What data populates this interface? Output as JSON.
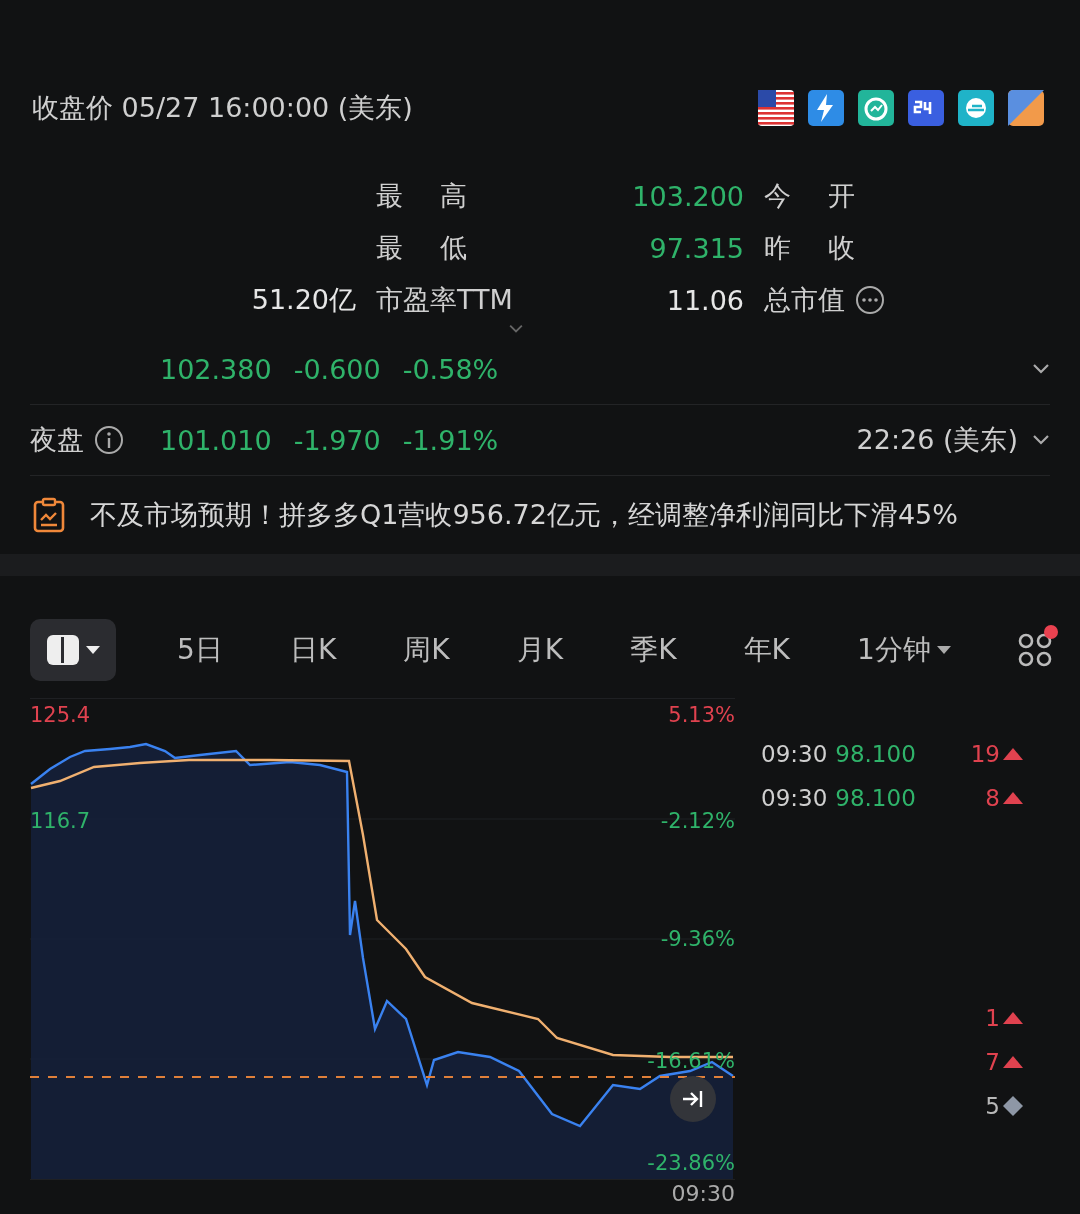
{
  "header": {
    "title": "收盘价 05/27 16:00:00 (美东)"
  },
  "stats": [
    {
      "cells": [
        {
          "kind": "empty"
        },
        {
          "kind": "label",
          "text": "最 高"
        },
        {
          "kind": "value",
          "text": "103.200",
          "color": "#2fb36a"
        },
        {
          "kind": "label",
          "text": "今 开"
        }
      ]
    },
    {
      "cells": [
        {
          "kind": "empty"
        },
        {
          "kind": "label",
          "text": "最 低"
        },
        {
          "kind": "value",
          "text": "97.315",
          "color": "#2fb36a"
        },
        {
          "kind": "label",
          "text": "昨 收"
        }
      ]
    },
    {
      "cells": [
        {
          "kind": "value",
          "text": "51.20亿",
          "color": "#e6e6e6"
        },
        {
          "kind": "label",
          "text": "市盈率TTM"
        },
        {
          "kind": "value",
          "text": "11.06",
          "color": "#e6e6e6"
        },
        {
          "kind": "label",
          "text": "总市值",
          "info": true
        }
      ]
    }
  ],
  "quotes": [
    {
      "values": [
        {
          "text": "102.380",
          "color": "#2fb36a"
        },
        {
          "text": "-0.600",
          "color": "#2fb36a"
        },
        {
          "text": "-0.58%",
          "color": "#2fb36a"
        }
      ]
    },
    {
      "label": "夜盘",
      "time": "22:26 (美东)",
      "values": [
        {
          "text": "101.010",
          "color": "#2fb36a"
        },
        {
          "text": "-1.970",
          "color": "#2fb36a"
        },
        {
          "text": "-1.91%",
          "color": "#2fb36a"
        }
      ]
    }
  ],
  "news": {
    "text": "不及市场预期！拼多多Q1营收956.72亿元，经调整净利润同比下滑45%"
  },
  "tabs": [
    {
      "kind": "layout"
    },
    {
      "kind": "text",
      "label": "5日",
      "selected": false
    },
    {
      "kind": "text",
      "label": "日K",
      "selected": false
    },
    {
      "kind": "text",
      "label": "周K",
      "selected": false
    },
    {
      "kind": "text",
      "label": "月K",
      "selected": false
    },
    {
      "kind": "text",
      "label": "季K",
      "selected": false
    },
    {
      "kind": "text",
      "label": "年K",
      "selected": false
    },
    {
      "kind": "dropdown",
      "label": "1分钟",
      "selected": false
    },
    {
      "kind": "grid",
      "badge": true
    }
  ],
  "chart": {
    "left_labels": [
      {
        "text": "125.4",
        "color": "#e0424f"
      },
      {
        "text": "116.7",
        "color": "#2fb36a"
      }
    ],
    "right_labels": [
      {
        "text": "5.13%",
        "color": "#e0424f"
      },
      {
        "text": "-2.12%",
        "color": "#2fb36a"
      },
      {
        "text": "-9.36%",
        "color": "#2fb36a"
      },
      {
        "text": "-16.61%",
        "color": "#2fb36a"
      },
      {
        "text": "-23.86%",
        "color": "#2fb36a"
      }
    ],
    "x_label": "09:30"
  },
  "trades": [
    {
      "kind": "up",
      "time": "09:30",
      "price": "98.100",
      "volume": "19"
    },
    {
      "kind": "up",
      "time": "09:30",
      "price": "98.100",
      "volume": "8"
    },
    {
      "kind": "blurred"
    },
    {
      "kind": "blurred"
    },
    {
      "kind": "blurred"
    },
    {
      "kind": "blurred"
    },
    {
      "kind": "up",
      "volume": "1"
    },
    {
      "kind": "up",
      "volume": "7"
    },
    {
      "kind": "neutral",
      "volume": "5"
    }
  ]
}
